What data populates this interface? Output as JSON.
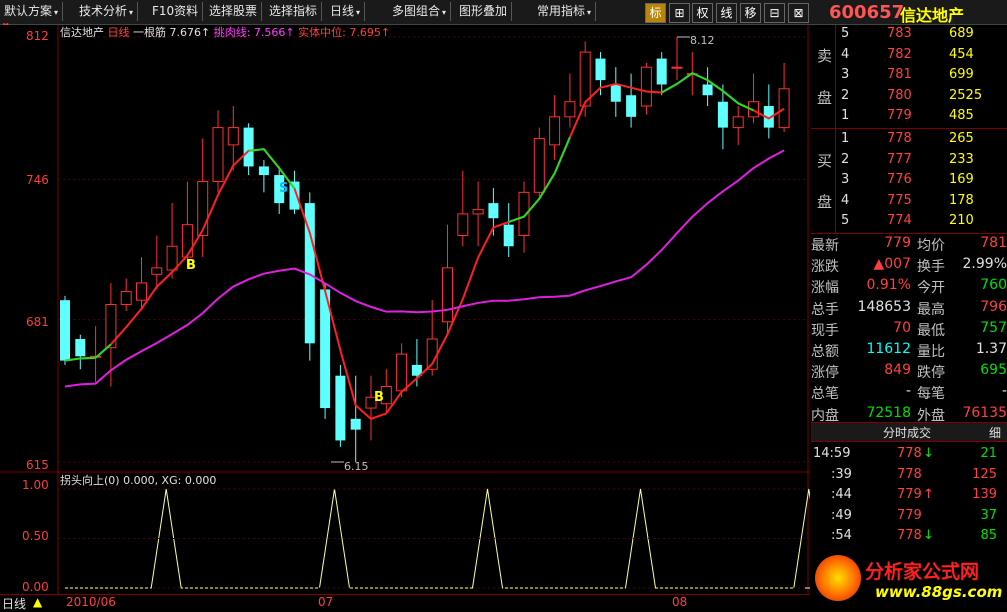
{
  "menubar": {
    "items": [
      {
        "label": "默认方案",
        "arrow": "▾"
      },
      {
        "label": "技术分析",
        "arrow": "▾"
      },
      {
        "label": "F10资料",
        "arrow": ""
      },
      {
        "label": "选择股票",
        "arrow": ""
      },
      {
        "label": "选择指标",
        "arrow": ""
      },
      {
        "label": "日线",
        "arrow": "▾"
      },
      {
        "label": "多图组合",
        "arrow": "▾"
      },
      {
        "label": "图形叠加",
        "arrow": ""
      },
      {
        "label": "常用指标",
        "arrow": "▾"
      }
    ],
    "tools": [
      "标",
      "⊞",
      "权",
      "线",
      "移",
      "⊟",
      "⊠"
    ]
  },
  "stock": {
    "code": "600657",
    "name": "信达地产"
  },
  "main_chart": {
    "header": {
      "name": "信达地产",
      "period": "日线",
      "k1_label": "一根筋 7.676",
      "k2_label": "挑肉线: 7.566",
      "k3_label": "实体中位: 7.695",
      "arrow": "↑"
    },
    "y_ticks": [
      "812",
      "746",
      "681",
      "615"
    ],
    "high_marker": "8.12",
    "low_marker": "6.15",
    "signals": [
      {
        "text": "B",
        "color": "#ffff00"
      },
      {
        "text": "S",
        "color": "#00bfff"
      },
      {
        "text": "B",
        "color": "#ffff00"
      }
    ]
  },
  "sub_chart": {
    "header": "拐头向上(0) 0.000, XG: 0.000",
    "y_ticks": [
      "1.00",
      "0.50",
      "0.00"
    ]
  },
  "bottom": {
    "period_label": "日线",
    "dates": [
      "2010/06",
      "07",
      "08"
    ]
  },
  "quote": {
    "sell_label": [
      "卖",
      "盘"
    ],
    "buy_label": [
      "买",
      "盘"
    ],
    "sell": [
      {
        "n": "5",
        "price": "783",
        "vol": "689"
      },
      {
        "n": "4",
        "price": "782",
        "vol": "454"
      },
      {
        "n": "3",
        "price": "781",
        "vol": "699"
      },
      {
        "n": "2",
        "price": "780",
        "vol": "2525"
      },
      {
        "n": "1",
        "price": "779",
        "vol": "485"
      }
    ],
    "buy": [
      {
        "n": "1",
        "price": "778",
        "vol": "265"
      },
      {
        "n": "2",
        "price": "777",
        "vol": "233"
      },
      {
        "n": "3",
        "price": "776",
        "vol": "169"
      },
      {
        "n": "4",
        "price": "775",
        "vol": "178"
      },
      {
        "n": "5",
        "price": "774",
        "vol": "210"
      }
    ],
    "stats": [
      {
        "l1": "最新",
        "v1": "779",
        "c1": "red",
        "l2": "均价",
        "v2": "781",
        "c2": "red"
      },
      {
        "l1": "涨跌",
        "v1": "▲007",
        "c1": "red",
        "l2": "换手",
        "v2": "2.99%",
        "c2": "white"
      },
      {
        "l1": "涨幅",
        "v1": "0.91%",
        "c1": "red",
        "l2": "今开",
        "v2": "760",
        "c2": "green"
      },
      {
        "l1": "总手",
        "v1": "148653",
        "c1": "white",
        "l2": "最高",
        "v2": "796",
        "c2": "red"
      },
      {
        "l1": "现手",
        "v1": "70",
        "c1": "red",
        "l2": "最低",
        "v2": "757",
        "c2": "green"
      },
      {
        "l1": "总额",
        "v1": "11612",
        "c1": "cyan",
        "l2": "量比",
        "v2": "1.37",
        "c2": "white"
      },
      {
        "l1": "涨停",
        "v1": "849",
        "c1": "red",
        "l2": "跌停",
        "v2": "695",
        "c2": "green"
      },
      {
        "l1": "总笔",
        "v1": "-",
        "c1": "white",
        "l2": "每笔",
        "v2": "-",
        "c2": "white"
      },
      {
        "l1": "内盘",
        "v1": "72518",
        "c1": "green",
        "l2": "外盘",
        "v2": "76135",
        "c2": "red"
      }
    ],
    "tick_tab": "分时成交",
    "tick_tab2": "细",
    "ticks": [
      {
        "time": "14:59",
        "price": "778",
        "arrow": "↓",
        "vol": "21"
      },
      {
        "time": ":39",
        "price": "778",
        "arrow": "",
        "vol": "125"
      },
      {
        "time": ":44",
        "price": "779",
        "arrow": "↑",
        "vol": "139"
      },
      {
        "time": ":49",
        "price": "779",
        "arrow": "",
        "vol": "37"
      },
      {
        "time": ":54",
        "price": "778",
        "arrow": "↓",
        "vol": "85"
      }
    ]
  },
  "watermark": {
    "cn": "分析家公式网",
    "url": "www.88gs.com"
  },
  "chart_data": {
    "type": "candlestick",
    "price_unit": "yuan (axis shows ×100)",
    "ylim": [
      6.15,
      8.12
    ],
    "candles": [
      [
        6.9,
        6.62,
        6.92,
        6.6
      ],
      [
        6.72,
        6.64,
        6.74,
        6.58
      ],
      [
        6.64,
        6.64,
        6.78,
        6.52
      ],
      [
        6.68,
        6.88,
        6.98,
        6.5
      ],
      [
        6.88,
        6.94,
        7.0,
        6.85
      ],
      [
        6.9,
        6.98,
        7.1,
        6.86
      ],
      [
        7.02,
        7.05,
        7.2,
        6.95
      ],
      [
        7.04,
        7.15,
        7.35,
        7.0
      ],
      [
        7.1,
        7.25,
        7.45,
        7.05
      ],
      [
        7.2,
        7.45,
        7.65,
        7.1
      ],
      [
        7.45,
        7.7,
        7.78,
        7.4
      ],
      [
        7.62,
        7.7,
        7.8,
        7.5
      ],
      [
        7.7,
        7.52,
        7.72,
        7.48
      ],
      [
        7.52,
        7.48,
        7.55,
        7.4
      ],
      [
        7.48,
        7.35,
        7.52,
        7.3
      ],
      [
        7.45,
        7.32,
        7.5,
        7.3
      ],
      [
        7.35,
        6.7,
        7.4,
        6.62
      ],
      [
        6.95,
        6.4,
        6.98,
        6.35
      ],
      [
        6.55,
        6.25,
        6.6,
        6.22
      ],
      [
        6.35,
        6.3,
        6.55,
        6.15
      ],
      [
        6.4,
        6.45,
        6.55,
        6.25
      ],
      [
        6.42,
        6.5,
        6.58,
        6.38
      ],
      [
        6.48,
        6.65,
        6.7,
        6.45
      ],
      [
        6.6,
        6.55,
        6.72,
        6.5
      ],
      [
        6.58,
        6.72,
        6.9,
        6.55
      ],
      [
        6.8,
        7.05,
        7.25,
        6.75
      ],
      [
        7.2,
        7.3,
        7.5,
        7.15
      ],
      [
        7.3,
        7.32,
        7.45,
        7.15
      ],
      [
        7.35,
        7.28,
        7.42,
        7.2
      ],
      [
        7.25,
        7.15,
        7.35,
        7.1
      ],
      [
        7.2,
        7.4,
        7.45,
        7.12
      ],
      [
        7.4,
        7.65,
        7.7,
        7.38
      ],
      [
        7.62,
        7.75,
        7.85,
        7.55
      ],
      [
        7.75,
        7.82,
        7.95,
        7.7
      ],
      [
        7.8,
        8.05,
        8.1,
        7.75
      ],
      [
        8.02,
        7.92,
        8.05,
        7.85
      ],
      [
        7.9,
        7.82,
        7.98,
        7.75
      ],
      [
        7.85,
        7.75,
        7.95,
        7.7
      ],
      [
        7.8,
        7.98,
        8.0,
        7.76
      ],
      [
        8.02,
        7.9,
        8.05,
        7.85
      ],
      [
        7.98,
        7.98,
        8.12,
        7.92
      ],
      [
        7.95,
        7.95,
        8.05,
        7.85
      ],
      [
        7.9,
        7.85,
        7.98,
        7.8
      ],
      [
        7.82,
        7.7,
        7.9,
        7.6
      ],
      [
        7.7,
        7.75,
        7.8,
        7.62
      ],
      [
        7.75,
        7.82,
        7.95,
        7.72
      ],
      [
        7.8,
        7.7,
        7.9,
        7.65
      ],
      [
        7.7,
        7.88,
        8.0,
        7.68
      ]
    ],
    "sub_series_peaks": [
      4,
      15,
      25,
      35,
      46
    ]
  }
}
